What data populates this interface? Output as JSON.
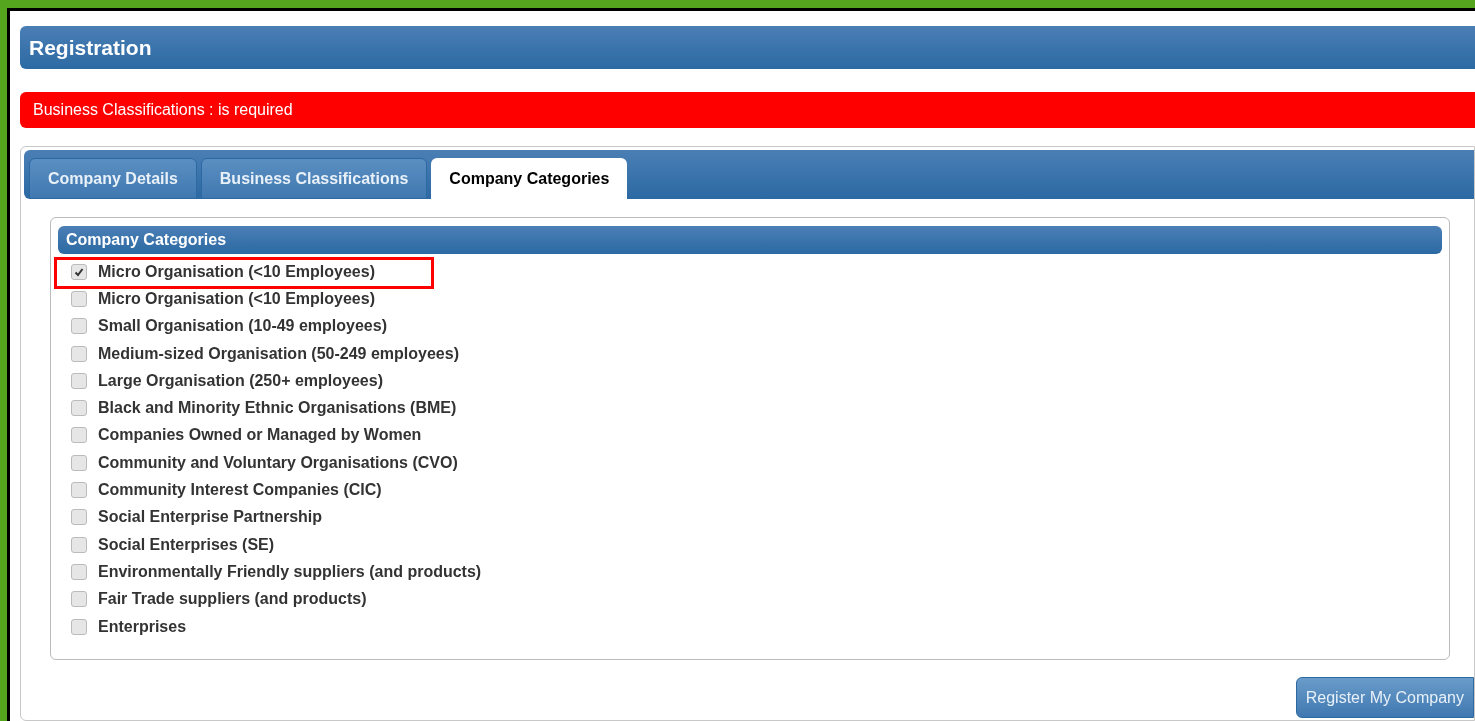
{
  "header": {
    "title": "Registration"
  },
  "error": {
    "message": "Business Classifications : is required"
  },
  "tabs": [
    {
      "label": "Company Details",
      "selected": false
    },
    {
      "label": "Business Classifications",
      "selected": false
    },
    {
      "label": "Company Categories",
      "selected": true
    }
  ],
  "group": {
    "title": "Company Categories",
    "items": [
      {
        "label": "Micro Organisation (<10 Employees)",
        "checked": true,
        "highlighted": true
      },
      {
        "label": "Micro Organisation (<10 Employees)",
        "checked": false,
        "highlighted": false
      },
      {
        "label": "Small Organisation (10-49 employees)",
        "checked": false,
        "highlighted": false
      },
      {
        "label": "Medium-sized Organisation (50-249 employees)",
        "checked": false,
        "highlighted": false
      },
      {
        "label": "Large Organisation (250+ employees)",
        "checked": false,
        "highlighted": false
      },
      {
        "label": "Black and Minority Ethnic Organisations (BME)",
        "checked": false,
        "highlighted": false
      },
      {
        "label": "Companies Owned or Managed by Women",
        "checked": false,
        "highlighted": false
      },
      {
        "label": "Community and Voluntary Organisations (CVO)",
        "checked": false,
        "highlighted": false
      },
      {
        "label": "Community Interest Companies (CIC)",
        "checked": false,
        "highlighted": false
      },
      {
        "label": "Social Enterprise Partnership",
        "checked": false,
        "highlighted": false
      },
      {
        "label": "Social Enterprises (SE)",
        "checked": false,
        "highlighted": false
      },
      {
        "label": "Environmentally Friendly suppliers (and products)",
        "checked": false,
        "highlighted": false
      },
      {
        "label": "Fair Trade suppliers (and products)",
        "checked": false,
        "highlighted": false
      },
      {
        "label": "Enterprises",
        "checked": false,
        "highlighted": false
      }
    ]
  },
  "submit": {
    "label": "Register My Company"
  }
}
